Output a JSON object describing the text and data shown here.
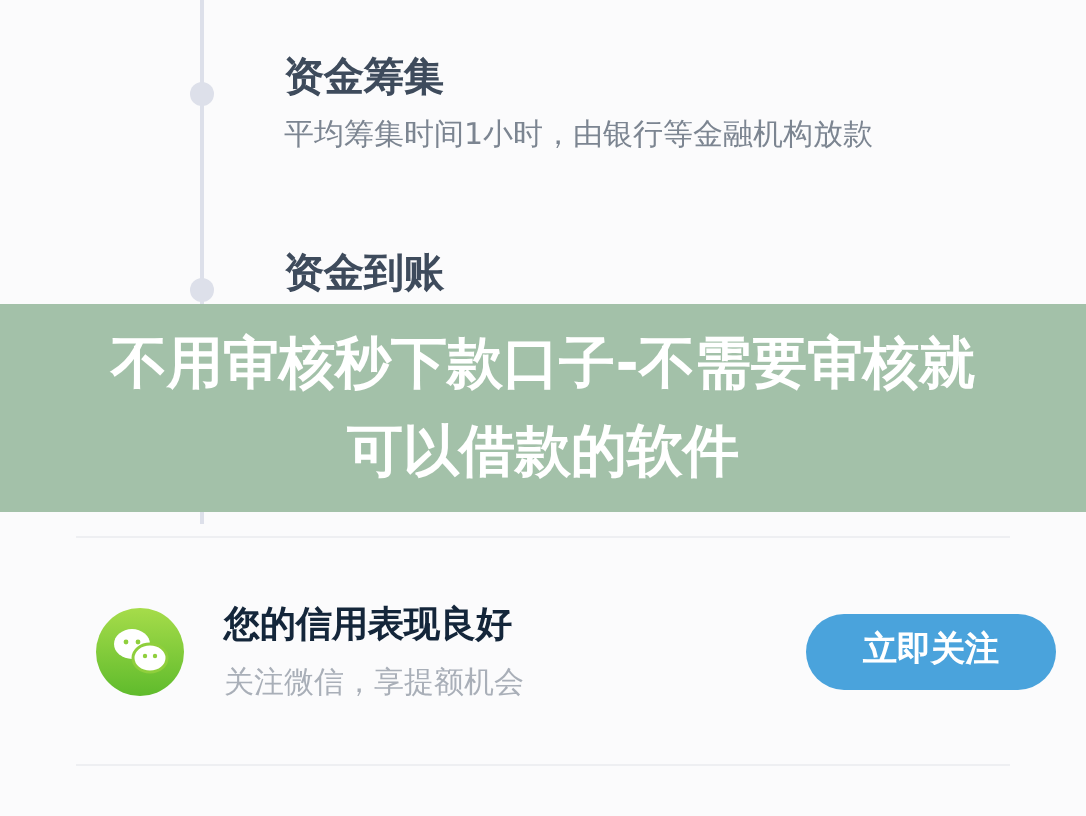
{
  "timeline": [
    {
      "title": "资金筹集",
      "description": "平均筹集时间1小时，由银行等金融机构放款"
    },
    {
      "title": "资金到账"
    }
  ],
  "banner": {
    "title": "不用审核秒下款口子-不需要审核就可以借款的软件"
  },
  "promo": {
    "title": "您的信用表现良好",
    "subtitle": "关注微信，享提额机会",
    "button": "立即关注"
  }
}
